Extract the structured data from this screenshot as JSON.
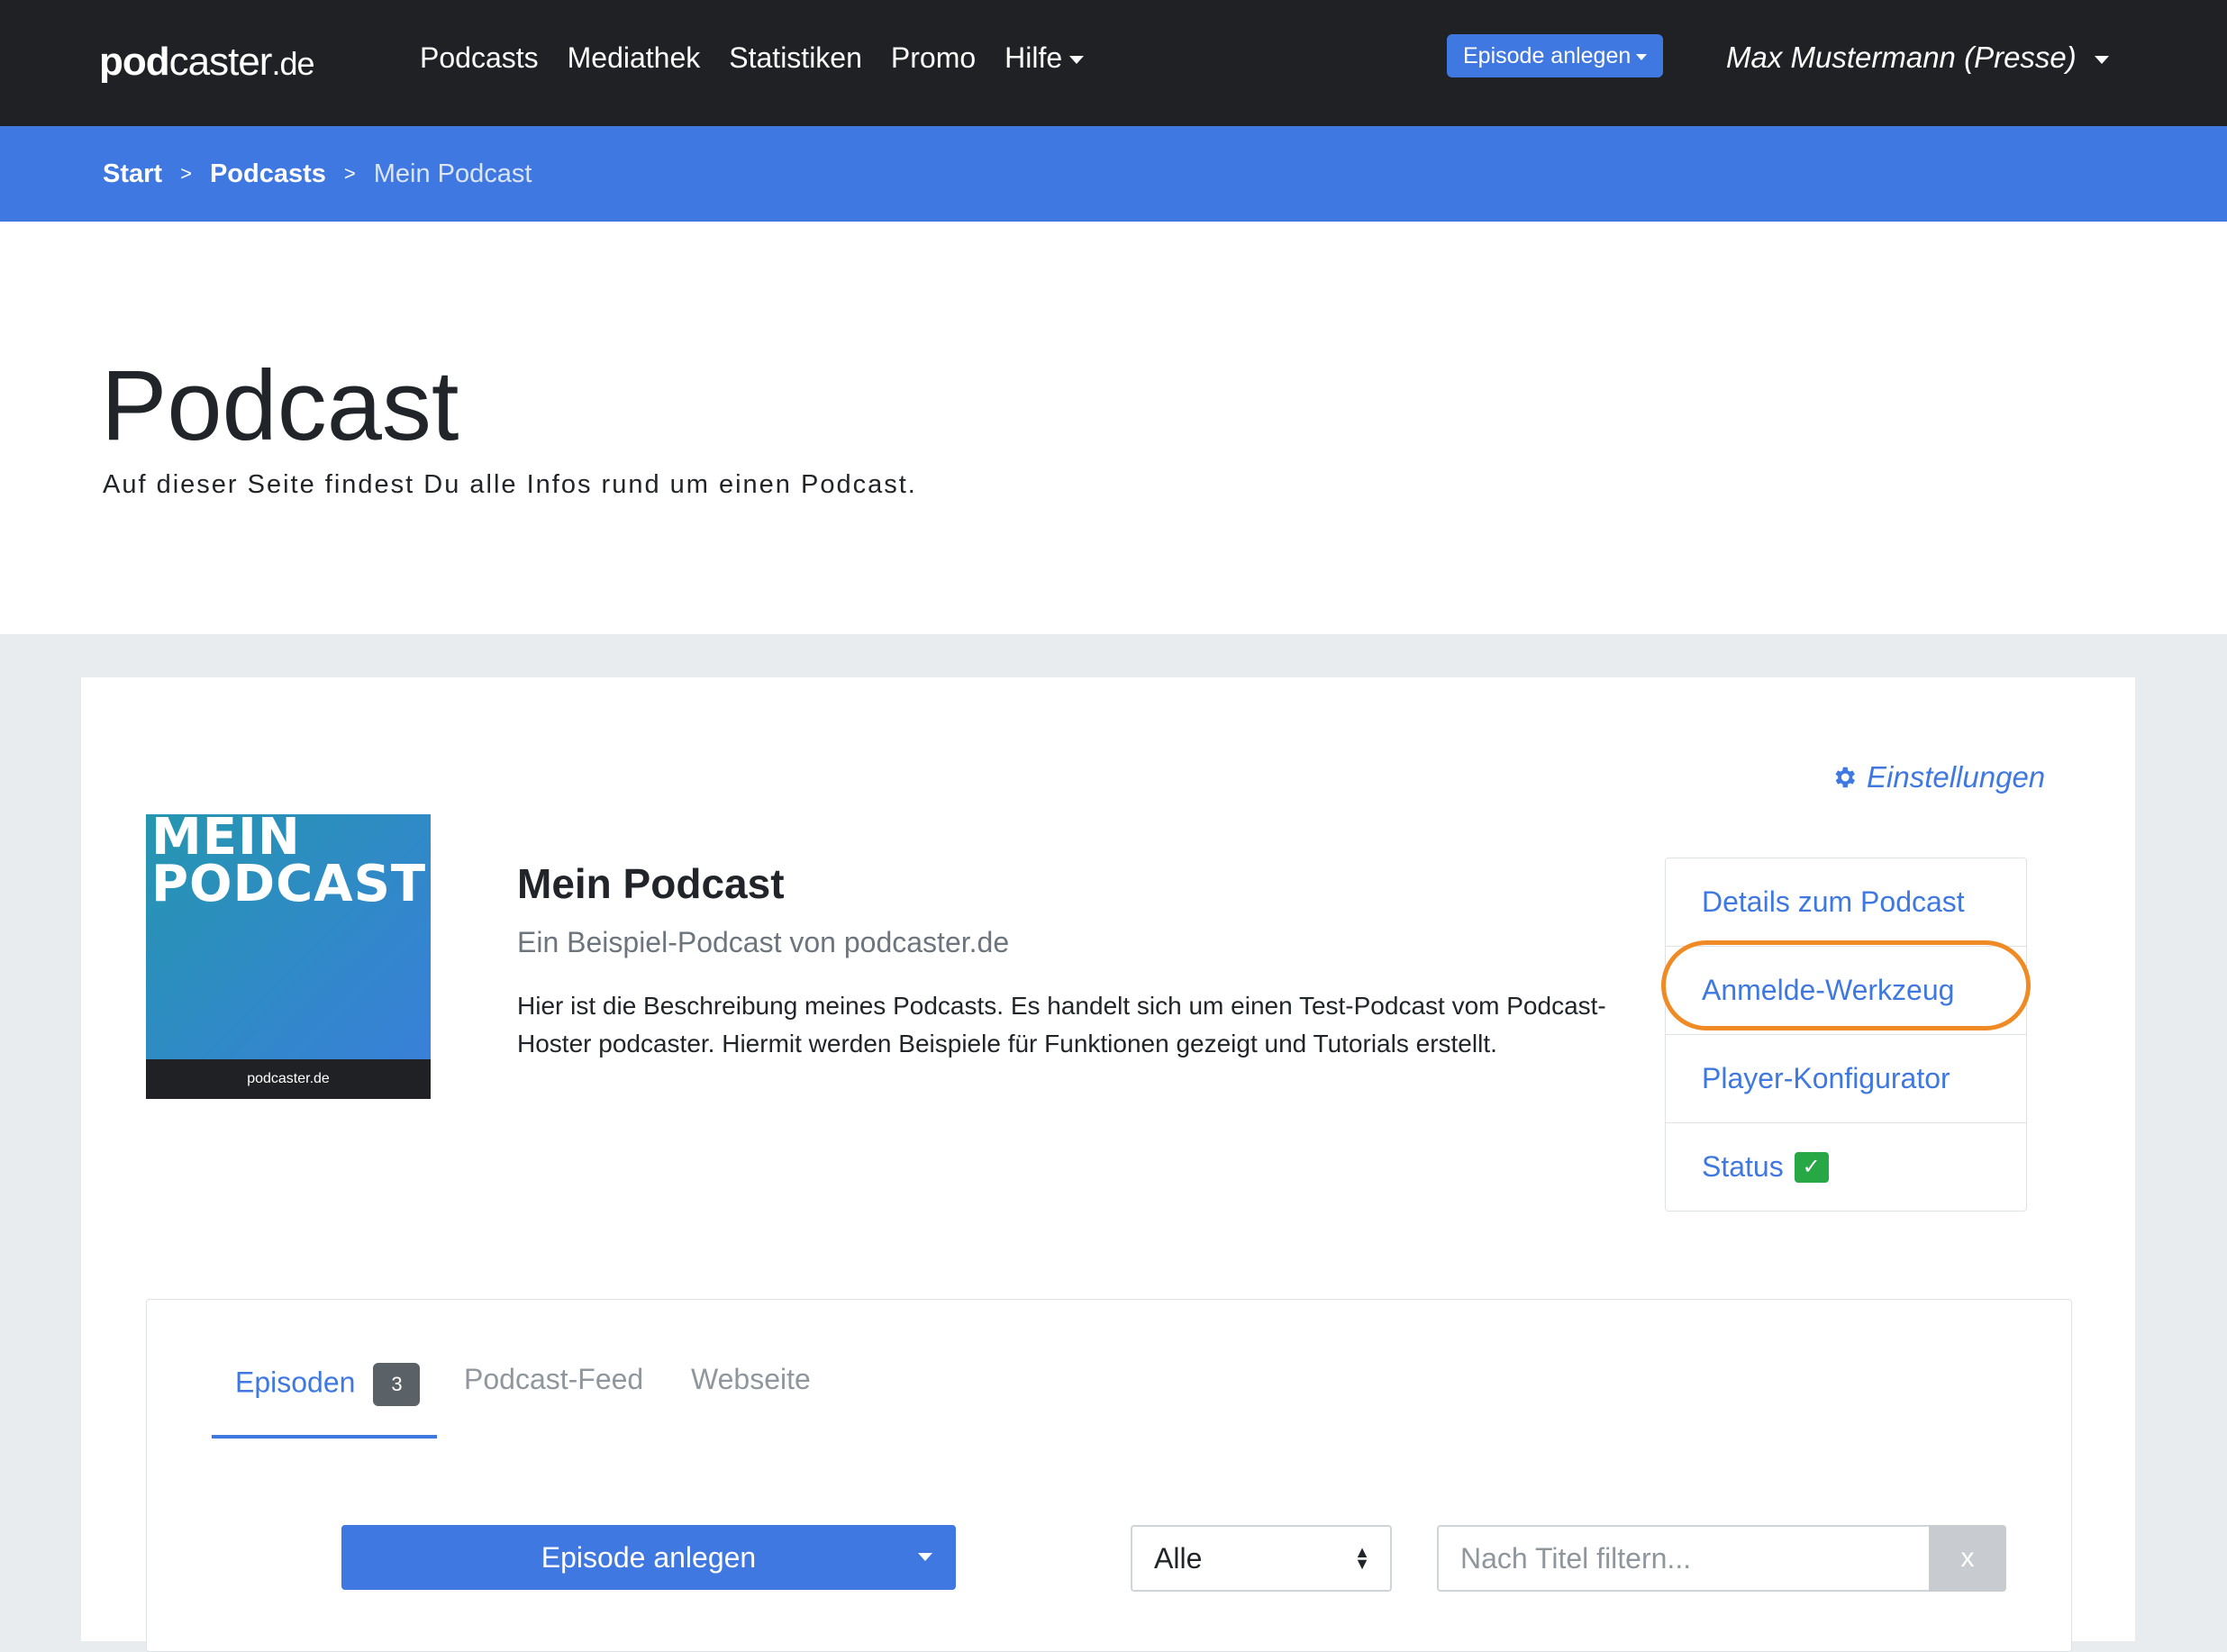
{
  "navbar": {
    "logo": {
      "pod": "pod",
      "caster": "caster",
      "de": ".de"
    },
    "links": [
      {
        "label": "Podcasts"
      },
      {
        "label": "Mediathek"
      },
      {
        "label": "Statistiken"
      },
      {
        "label": "Promo"
      },
      {
        "label": "Hilfe"
      }
    ],
    "episode_button": "Episode anlegen",
    "user": "Max Mustermann (Presse)"
  },
  "breadcrumb": {
    "items": [
      "Start",
      "Podcasts"
    ],
    "current": "Mein Podcast",
    "separator": ">"
  },
  "header": {
    "title": "Podcast",
    "subtitle": "Auf dieser Seite findest Du alle Infos rund um einen Podcast."
  },
  "podcast": {
    "settings_label": "Einstellungen",
    "cover": {
      "line1": "MEIN",
      "line2": "PODCAST",
      "footer": "podcaster.de"
    },
    "name": "Mein Podcast",
    "tagline": "Ein Beispiel-Podcast von podcaster.de",
    "description": "Hier ist die Beschreibung meines Podcasts. Es handelt sich um einen Test-Podcast vom Podcast-Hoster podcaster. Hiermit werden Beispiele für Funktionen gezeigt und Tutorials erstellt."
  },
  "side_menu": {
    "items": [
      "Details zum Podcast",
      "Anmelde-Werkzeug",
      "Player-Konfigurator",
      "Status"
    ],
    "status_mark": "✓",
    "highlighted": "Anmelde-Werkzeug"
  },
  "tabs": [
    {
      "label": "Episoden",
      "count": "3"
    },
    {
      "label": "Podcast-Feed"
    },
    {
      "label": "Webseite"
    }
  ],
  "episodes": {
    "create_button": "Episode anlegen",
    "filter_select": "Alle",
    "search_placeholder": "Nach Titel filtern...",
    "clear_label": "x"
  },
  "colors": {
    "navbar": "#1f2124",
    "accent": "#3f78e0",
    "highlight": "#f08a24",
    "status_ok": "#28a745"
  }
}
